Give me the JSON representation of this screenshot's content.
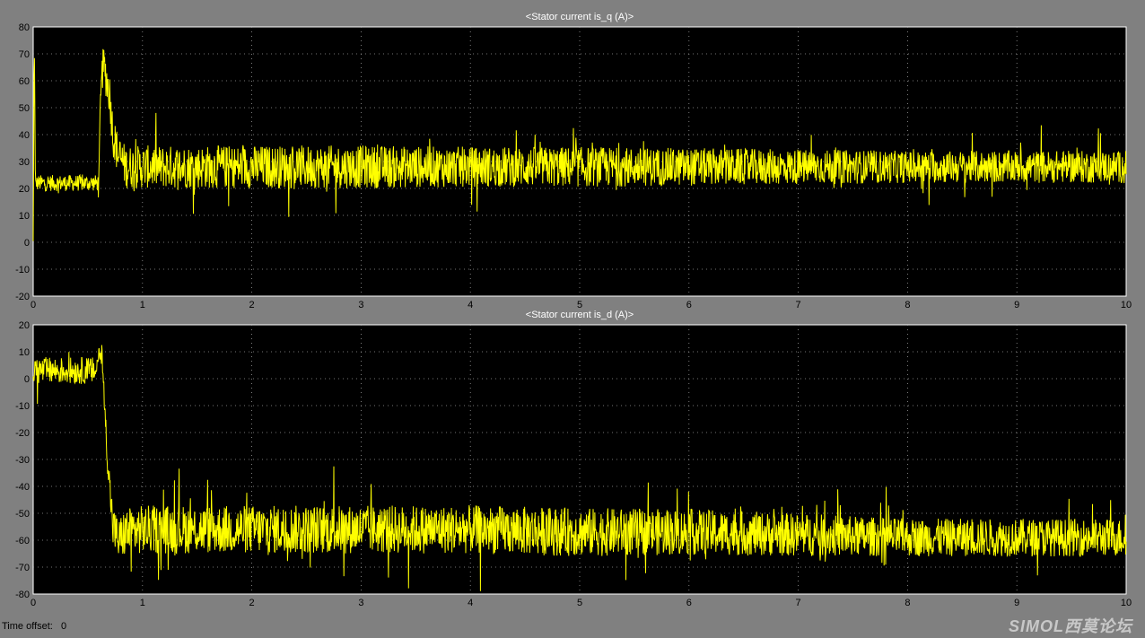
{
  "chart_data": [
    {
      "type": "line",
      "title": "<Stator current is_q (A)>",
      "xlabel": "",
      "ylabel": "",
      "xlim": [
        0,
        10
      ],
      "ylim": [
        -20,
        80
      ],
      "xticks": [
        "0",
        "1",
        "2",
        "3",
        "4",
        "5",
        "6",
        "7",
        "8",
        "9",
        "10"
      ],
      "yticks": [
        "80",
        "70",
        "60",
        "50",
        "40",
        "30",
        "20",
        "10",
        "0",
        "-10",
        "-20"
      ],
      "grid": true,
      "series": [
        {
          "color": "#ffff00",
          "x": [
            0,
            0.01,
            0.02,
            0.04,
            0.3,
            0.58,
            0.6,
            0.62,
            0.65,
            0.7,
            0.73,
            0.78,
            0.85,
            1,
            2,
            3,
            4,
            5,
            6,
            7,
            8,
            9,
            10
          ],
          "y": [
            0,
            78,
            22,
            22,
            22,
            22,
            22,
            62,
            65,
            55,
            40,
            32,
            28,
            28,
            28,
            28,
            28,
            28,
            28,
            28,
            28,
            28,
            28
          ],
          "band": [
            1.5,
            1.5,
            1.5,
            3,
            3,
            3,
            3,
            8,
            8,
            8,
            8,
            8,
            8,
            8,
            8,
            8,
            7.5,
            7.5,
            7,
            6.5,
            6,
            6,
            6
          ]
        }
      ]
    },
    {
      "type": "line",
      "title": "<Stator current is_d (A)>",
      "xlabel": "",
      "ylabel": "",
      "xlim": [
        0,
        10
      ],
      "ylim": [
        -80,
        20
      ],
      "xticks": [
        "0",
        "1",
        "2",
        "3",
        "4",
        "5",
        "6",
        "7",
        "8",
        "9",
        "10"
      ],
      "yticks": [
        "20",
        "10",
        "0",
        "-10",
        "-20",
        "-30",
        "-40",
        "-50",
        "-60",
        "-70",
        "-80"
      ],
      "grid": true,
      "series": [
        {
          "color": "#ffff00",
          "x": [
            0,
            0.3,
            0.58,
            0.6,
            0.63,
            0.68,
            0.73,
            0.78,
            0.85,
            1,
            2,
            3,
            4,
            5,
            6,
            7,
            8,
            9,
            10
          ],
          "y": [
            3,
            3,
            3,
            10,
            8,
            -30,
            -55,
            -60,
            -57,
            -56,
            -56,
            -56,
            -56,
            -57,
            -57,
            -58,
            -59,
            -59,
            -59
          ],
          "band": [
            5,
            5,
            5,
            3,
            4,
            5,
            8,
            8,
            9,
            9,
            9,
            9,
            9,
            9,
            8.5,
            8,
            7,
            7,
            7
          ]
        }
      ]
    }
  ],
  "footer": {
    "time_offset_label": "Time offset:",
    "time_offset_value": "0"
  },
  "watermark": "SIMOL西莫论坛"
}
